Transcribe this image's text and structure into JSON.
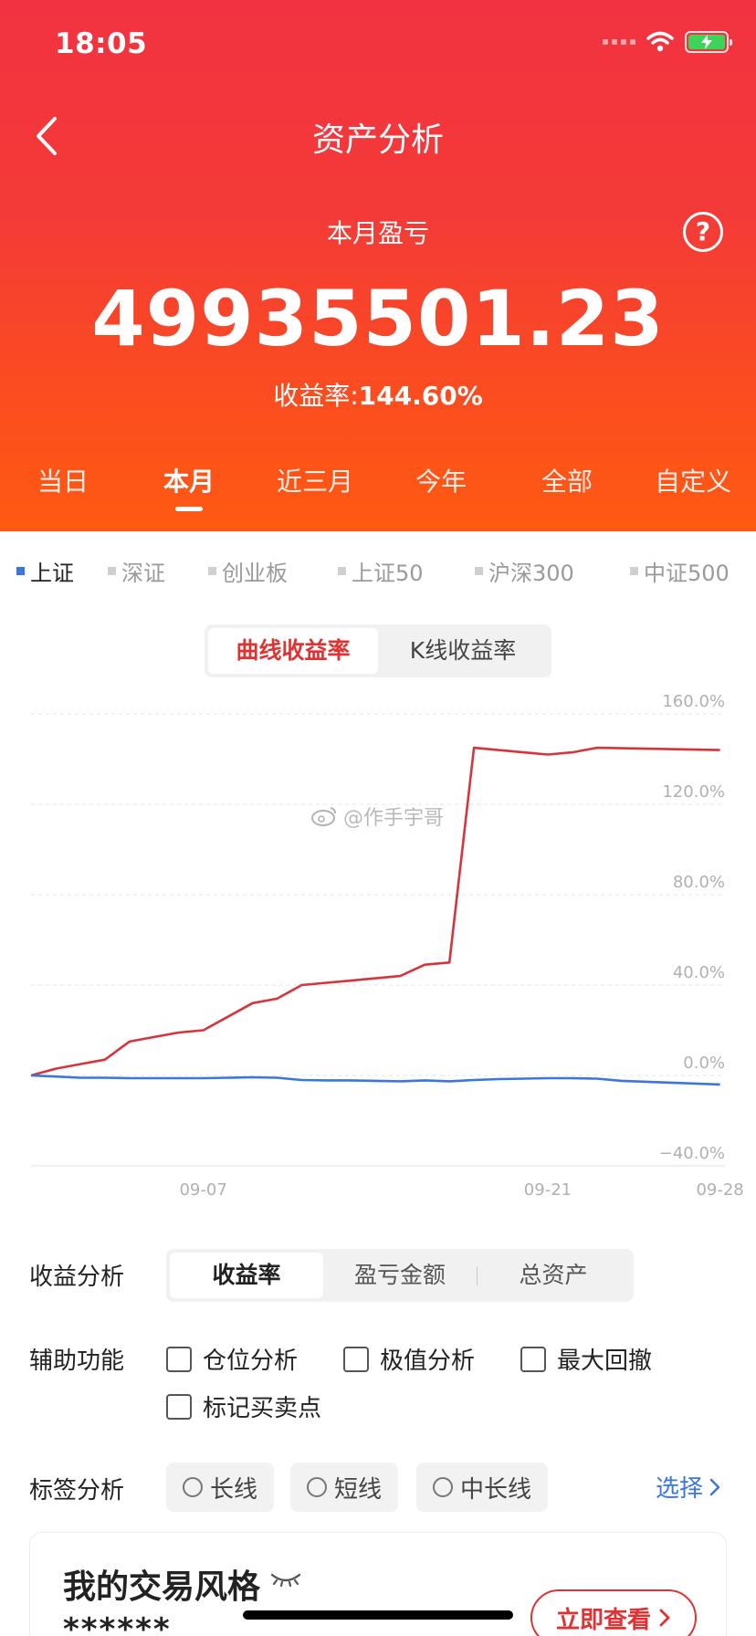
{
  "status": {
    "time": "18:05"
  },
  "nav": {
    "title": "资产分析"
  },
  "summary": {
    "month_label": "本月盈亏",
    "amount": "49935501.23",
    "yield_label": "收益率:",
    "yield_value": "144.60%"
  },
  "period_tabs": [
    {
      "label": "当日",
      "active": false
    },
    {
      "label": "本月",
      "active": true
    },
    {
      "label": "近三月",
      "active": false
    },
    {
      "label": "今年",
      "active": false
    },
    {
      "label": "全部",
      "active": false
    },
    {
      "label": "自定义",
      "active": false
    }
  ],
  "index_tabs": [
    {
      "label": "上证",
      "active": true
    },
    {
      "label": "深证",
      "active": false
    },
    {
      "label": "创业板",
      "active": false
    },
    {
      "label": "上证50",
      "active": false
    },
    {
      "label": "沪深300",
      "active": false
    },
    {
      "label": "中证500",
      "active": false
    }
  ],
  "chart_mode": {
    "options": [
      "曲线收益率",
      "K线收益率"
    ],
    "selected": "曲线收益率"
  },
  "watermark": "@作手宇哥",
  "chart_data": {
    "type": "line",
    "ylim": [
      -40,
      160
    ],
    "y_ticks": [
      "160.0%",
      "120.0%",
      "80.0%",
      "40.0%",
      "0.0%",
      "−40.0%"
    ],
    "y_tick_values": [
      160,
      120,
      80,
      40,
      0,
      -40
    ],
    "x_ticks": [
      "09-07",
      "09-21",
      "09-28"
    ],
    "x_tick_positions": [
      7,
      21,
      28
    ],
    "xlim": [
      0,
      28.2
    ],
    "grid": true,
    "series": [
      {
        "color": "#d8333b",
        "x": [
          0,
          1,
          2,
          3,
          4,
          5,
          6,
          7,
          8,
          9,
          10,
          11,
          12,
          13,
          14,
          15,
          16,
          17,
          18,
          19,
          20,
          21,
          22,
          23,
          24,
          25,
          26,
          27,
          28
        ],
        "y": [
          0,
          3,
          5,
          7,
          15,
          17,
          19,
          20,
          26,
          32,
          34,
          40,
          41,
          42,
          43,
          44,
          49,
          50,
          145,
          144,
          143,
          142,
          143,
          145,
          144.8,
          144.6,
          144.4,
          144.2,
          144.0
        ]
      },
      {
        "color": "#3a76dc",
        "x": [
          0,
          1,
          2,
          3,
          4,
          5,
          6,
          7,
          8,
          9,
          10,
          11,
          12,
          13,
          14,
          15,
          16,
          17,
          18,
          19,
          20,
          21,
          22,
          23,
          24,
          25,
          26,
          27,
          28
        ],
        "y": [
          0,
          -0.5,
          -1,
          -1,
          -1.2,
          -1.2,
          -1.2,
          -1.2,
          -1,
          -0.8,
          -1,
          -2,
          -2.2,
          -2.2,
          -2.4,
          -2.6,
          -2.2,
          -2.6,
          -2,
          -1.6,
          -1.4,
          -1.2,
          -1.2,
          -1.4,
          -2.4,
          -2.8,
          -3.2,
          -3.6,
          -4
        ]
      }
    ]
  },
  "profit_analysis": {
    "label": "收益分析",
    "options": [
      "收益率",
      "盈亏金额",
      "总资产"
    ],
    "selected": "收益率"
  },
  "aux": {
    "label": "辅助功能",
    "items": [
      "仓位分析",
      "极值分析",
      "最大回撤",
      "标记买卖点"
    ]
  },
  "tags": {
    "label": "标签分析",
    "items": [
      "长线",
      "短线",
      "中长线"
    ],
    "select_label": "选择"
  },
  "style_card": {
    "title": "我的交易风格",
    "masked": "******",
    "button": "立即查看"
  }
}
